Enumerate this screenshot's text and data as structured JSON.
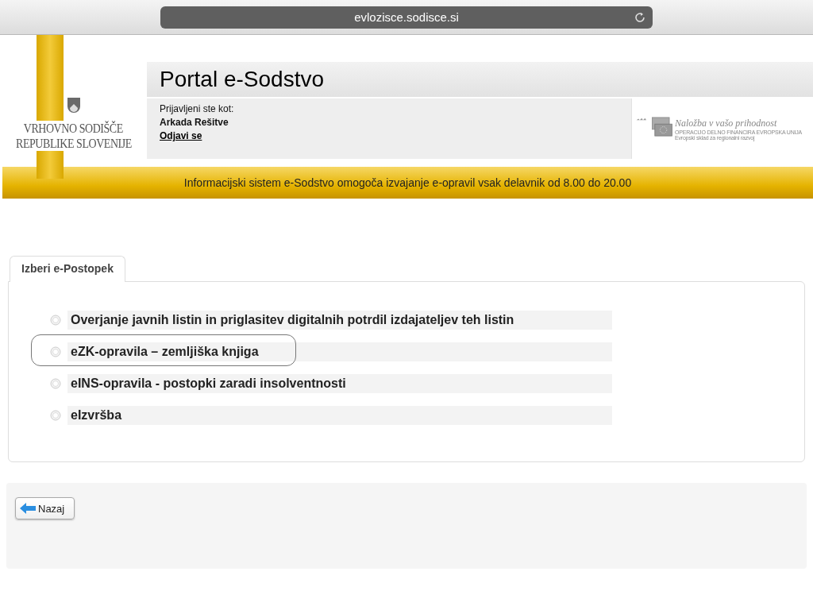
{
  "browser": {
    "url": "evlozisce.sodisce.si"
  },
  "logo": {
    "lines": [
      "VRHOVNO SODIŠČE",
      "REPUBLIKE SLOVENIJE"
    ]
  },
  "header": {
    "title": "Portal e-Sodstvo",
    "login_label": "Prijavljeni ste kot:",
    "user": "Arkada Rešitve",
    "logout": "Odjavi se"
  },
  "eu_logo": {
    "slogan": "Naložba v vašo prihodnost",
    "line_1": "OPERACIJO DELNO FINANCIRA EVROPSKA UNIJA",
    "line_2": "Evropski sklad za regionalni razvoj"
  },
  "banner": "Informacijski sistem e-Sodstvo omogoča izvajanje e-opravil vsak delavnik od 8.00 do 20.00",
  "tabs": [
    {
      "label": "Izberi e-Postopek",
      "selected": true
    }
  ],
  "procedures": [
    {
      "label": "Overjanje javnih listin in priglasitev digitalnih potrdil izdajateljev teh listin",
      "selected": false
    },
    {
      "label": "eZK-opravila – zemljiška knjiga",
      "selected": true
    },
    {
      "label": "eINS-opravila - postopki zaradi insolventnosti",
      "selected": false
    },
    {
      "label": "eIzvršba",
      "selected": false
    }
  ],
  "back_button": "Nazaj"
}
